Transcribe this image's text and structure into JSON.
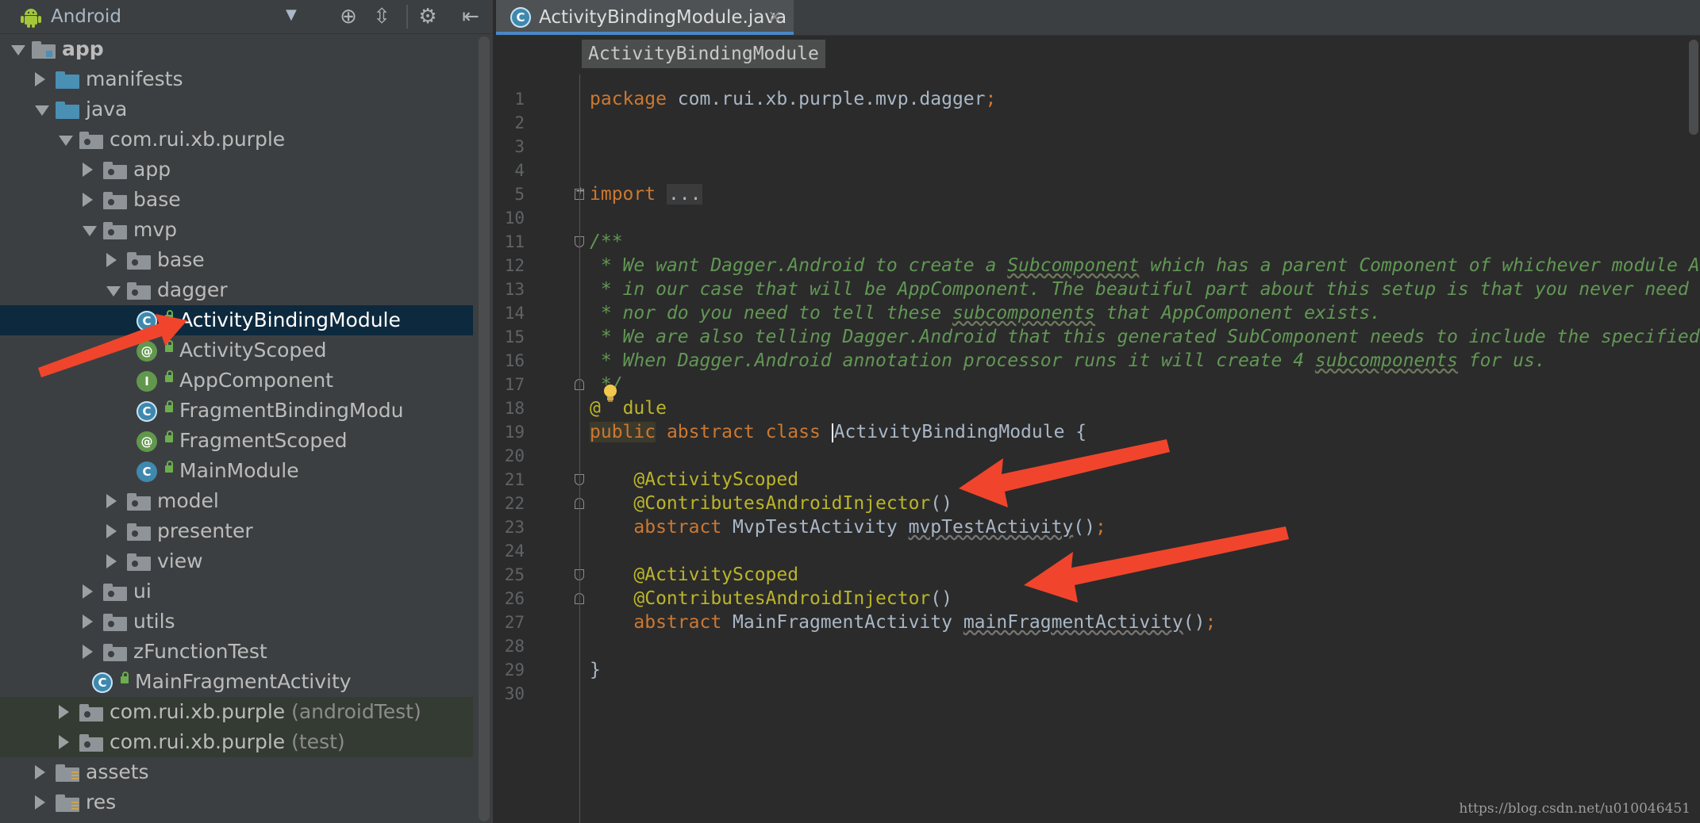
{
  "project_panel": {
    "view_name": "Android",
    "toolbar_icons": [
      "target-icon",
      "collapse-all-icon",
      "gear-icon",
      "hide-panel-icon"
    ],
    "tree": [
      {
        "label": "app",
        "depth": 0,
        "state": "expanded",
        "icon": "module",
        "bold": true
      },
      {
        "label": "manifests",
        "depth": 1,
        "state": "collapsed",
        "icon": "folder-blue"
      },
      {
        "label": "java",
        "depth": 1,
        "state": "expanded",
        "icon": "folder-blue"
      },
      {
        "label": "com.rui.xb.purple",
        "depth": 2,
        "state": "expanded",
        "icon": "package"
      },
      {
        "label": "app",
        "depth": 3,
        "state": "collapsed",
        "icon": "package"
      },
      {
        "label": "base",
        "depth": 3,
        "state": "collapsed",
        "icon": "package"
      },
      {
        "label": "mvp",
        "depth": 3,
        "state": "expanded",
        "icon": "package"
      },
      {
        "label": "base",
        "depth": 4,
        "state": "collapsed",
        "icon": "package"
      },
      {
        "label": "dagger",
        "depth": 4,
        "state": "expanded",
        "icon": "package"
      },
      {
        "label": "ActivityBindingModule",
        "depth": 5,
        "state": "leaf",
        "icon": "class-ring",
        "selected": true
      },
      {
        "label": "ActivityScoped",
        "depth": 5,
        "state": "leaf",
        "icon": "annotation"
      },
      {
        "label": "AppComponent",
        "depth": 5,
        "state": "leaf",
        "icon": "interface"
      },
      {
        "label": "FragmentBindingModu",
        "depth": 5,
        "state": "leaf",
        "icon": "class-ring"
      },
      {
        "label": "FragmentScoped",
        "depth": 5,
        "state": "leaf",
        "icon": "annotation"
      },
      {
        "label": "MainModule",
        "depth": 5,
        "state": "leaf",
        "icon": "class"
      },
      {
        "label": "model",
        "depth": 4,
        "state": "collapsed",
        "icon": "package"
      },
      {
        "label": "presenter",
        "depth": 4,
        "state": "collapsed",
        "icon": "package"
      },
      {
        "label": "view",
        "depth": 4,
        "state": "collapsed",
        "icon": "package"
      },
      {
        "label": "ui",
        "depth": 3,
        "state": "collapsed",
        "icon": "package"
      },
      {
        "label": "utils",
        "depth": 3,
        "state": "collapsed",
        "icon": "package"
      },
      {
        "label": "zFunctionTest",
        "depth": 3,
        "state": "collapsed",
        "icon": "package"
      },
      {
        "label": "MainFragmentActivity",
        "depth": 3,
        "state": "leaf",
        "icon": "class-ring"
      },
      {
        "label": "com.rui.xb.purple",
        "suffix": "(androidTest)",
        "depth": 2,
        "state": "collapsed",
        "icon": "package",
        "testbg": true
      },
      {
        "label": "com.rui.xb.purple",
        "suffix": "(test)",
        "depth": 2,
        "state": "collapsed",
        "icon": "package",
        "testbg": true
      },
      {
        "label": "assets",
        "depth": 1,
        "state": "collapsed",
        "icon": "folder-res"
      },
      {
        "label": "res",
        "depth": 1,
        "state": "collapsed",
        "icon": "folder-res"
      }
    ]
  },
  "editor": {
    "tab": {
      "label": "ActivityBindingModule.java",
      "close": "×"
    },
    "breadcrumb": "ActivityBindingModule",
    "line_numbers": [
      "1",
      "2",
      "3",
      "4",
      "5",
      "10",
      "11",
      "12",
      "13",
      "14",
      "15",
      "16",
      "17",
      "18",
      "19",
      "20",
      "21",
      "22",
      "23",
      "24",
      "25",
      "26",
      "27",
      "28",
      "29",
      "30"
    ],
    "lines": [
      [
        {
          "t": "package ",
          "c": "kw"
        },
        {
          "t": "com.rui.xb.purple.mvp.dagger",
          "c": ""
        },
        {
          "t": ";",
          "c": "kw"
        }
      ],
      [],
      [],
      [],
      [
        {
          "t": "import ",
          "c": "kw"
        },
        {
          "t": "...",
          "c": "fold-box"
        }
      ],
      [],
      [
        {
          "t": "/**",
          "c": "cm"
        }
      ],
      [
        {
          "t": " * We want Dagger.Android to create a ",
          "c": "cm"
        },
        {
          "t": "Subcomponent",
          "c": "cm sq"
        },
        {
          "t": " which has a parent Component of whichever module ActivityBindingModule is on,",
          "c": "cm"
        }
      ],
      [
        {
          "t": " * in our case that will be AppComponent. The beautiful part about this setup is that you never need to tell AppComponent that it is going to have all these subcomponents",
          "c": "cm"
        }
      ],
      [
        {
          "t": " * nor do you need to tell these ",
          "c": "cm"
        },
        {
          "t": "subcomponents",
          "c": "cm sq"
        },
        {
          "t": " that AppComponent exists.",
          "c": "cm"
        }
      ],
      [
        {
          "t": " * We are also telling Dagger.Android that this generated SubComponent needs to include the specified modules and be aware of a scope annotation",
          "c": "cm"
        }
      ],
      [
        {
          "t": " * When Dagger.Android annotation processor runs it will create 4 ",
          "c": "cm"
        },
        {
          "t": "subcomponents",
          "c": "cm sq"
        },
        {
          "t": " for us.",
          "c": "cm"
        }
      ],
      [
        {
          "t": " */",
          "c": "cm"
        }
      ],
      [
        {
          "t": "@",
          "c": "an"
        },
        {
          "t": "  ",
          "c": ""
        },
        {
          "t": "dule",
          "c": "an"
        }
      ],
      [
        {
          "t": "public",
          "c": "kw hl-public"
        },
        {
          "t": " abstract class ",
          "c": "kw"
        },
        {
          "t": "|",
          "c": "caret"
        },
        {
          "t": "ActivityBindingModule {",
          "c": ""
        }
      ],
      [],
      [
        {
          "t": "    @ActivityScoped",
          "c": "an"
        }
      ],
      [
        {
          "t": "    @ContributesAndroidInjector",
          "c": "an"
        },
        {
          "t": "()",
          "c": ""
        }
      ],
      [
        {
          "t": "    abstract ",
          "c": "kw"
        },
        {
          "t": "MvpTestActivity ",
          "c": ""
        },
        {
          "t": "mvpTestActivity",
          "c": "sqg"
        },
        {
          "t": "()",
          "c": ""
        },
        {
          "t": ";",
          "c": "kw"
        }
      ],
      [],
      [
        {
          "t": "    @ActivityScoped",
          "c": "an"
        }
      ],
      [
        {
          "t": "    @ContributesAndroidInjector",
          "c": "an"
        },
        {
          "t": "()",
          "c": ""
        }
      ],
      [
        {
          "t": "    abstract ",
          "c": "kw"
        },
        {
          "t": "MainFragmentActivity ",
          "c": ""
        },
        {
          "t": "mainFragmentActivity",
          "c": "sqg"
        },
        {
          "t": "()",
          "c": ""
        },
        {
          "t": ";",
          "c": "kw"
        }
      ],
      [],
      [
        {
          "t": "}",
          "c": ""
        }
      ],
      []
    ],
    "fold_marks": [
      {
        "line_index": 4,
        "kind": "plus"
      },
      {
        "line_index": 6,
        "kind": "open"
      },
      {
        "line_index": 12,
        "kind": "close"
      },
      {
        "line_index": 16,
        "kind": "open"
      },
      {
        "line_index": 17,
        "kind": "close"
      },
      {
        "line_index": 20,
        "kind": "open"
      },
      {
        "line_index": 21,
        "kind": "close"
      }
    ],
    "intention_icon": "lightbulb-icon"
  },
  "watermark": "https://blog.csdn.net/u010046451",
  "colors": {
    "annotation_arrow": "#f0452c",
    "keyword": "#cc7832",
    "annotation": "#bbb529",
    "comment": "#629755"
  }
}
